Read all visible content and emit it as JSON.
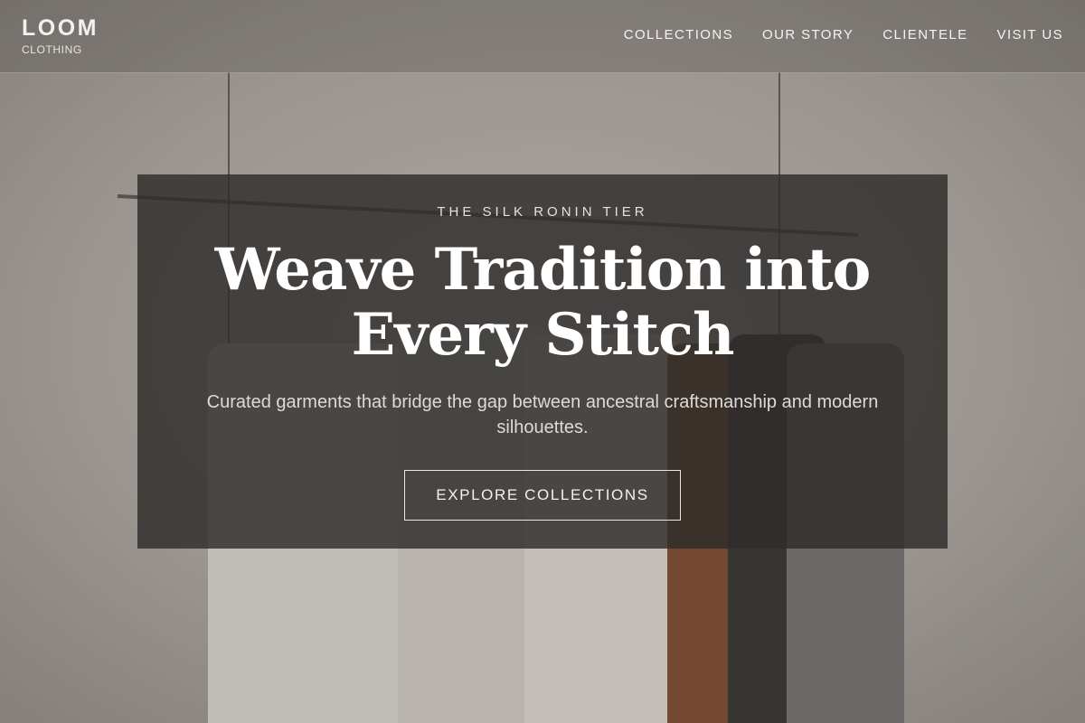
{
  "brand": {
    "name": "LOOM",
    "subtitle": "CLOTHING"
  },
  "nav": {
    "items": [
      {
        "label": "COLLECTIONS"
      },
      {
        "label": "OUR STORY"
      },
      {
        "label": "CLIENTELE"
      },
      {
        "label": "VISIT US"
      }
    ]
  },
  "hero": {
    "eyebrow": "THE SILK RONIN TIER",
    "headline_line1": "Weave Tradition into",
    "headline_line2": "Every Stitch",
    "subtitle": "Curated garments that bridge the gap between ancestral craftsmanship and modern silhouettes.",
    "cta_label": "EXPLORE COLLECTIONS"
  },
  "background": {
    "description_icon": "clothing-rack-photo"
  },
  "colors": {
    "header_overlay": "#46423e",
    "card_background": "#2e2c2b",
    "text_primary": "#ffffff",
    "text_muted": "#dedad7",
    "button_border": "#e9e6e3"
  }
}
